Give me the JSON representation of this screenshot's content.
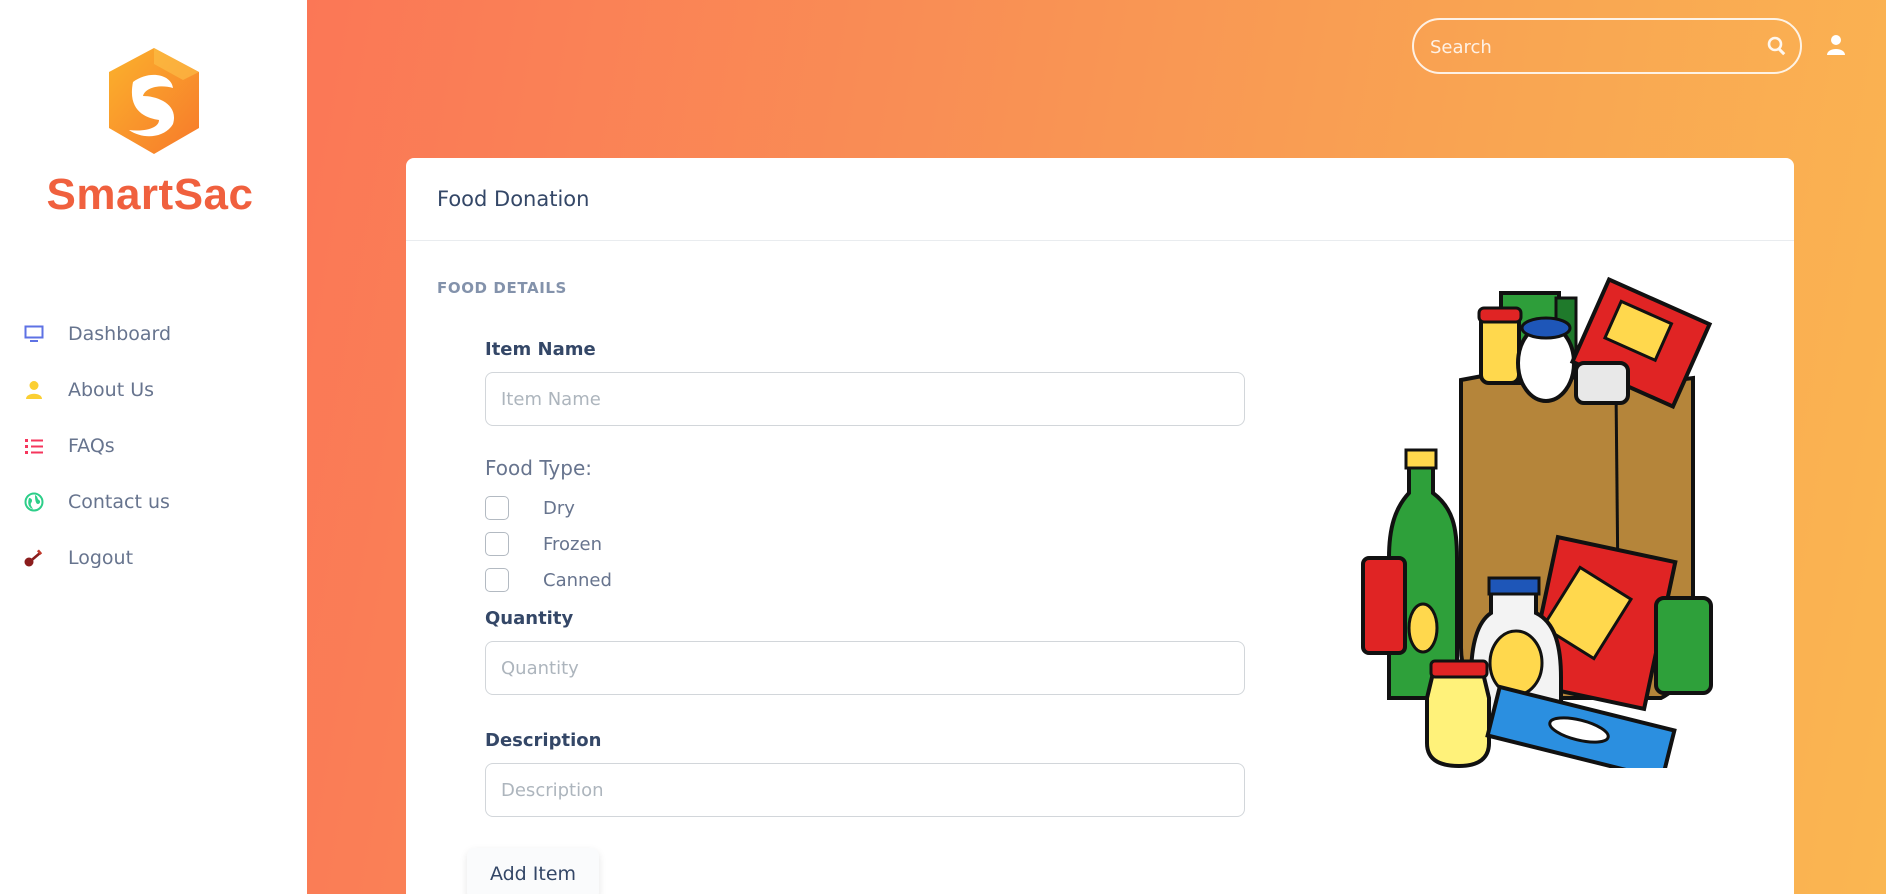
{
  "brand": {
    "name": "SmartSac",
    "color": "#f0603e"
  },
  "sidebar": {
    "items": [
      {
        "label": "Dashboard",
        "icon": "monitor-icon",
        "color": "#5e72e4"
      },
      {
        "label": "About Us",
        "icon": "user-icon",
        "color": "#fbcf33"
      },
      {
        "label": "FAQs",
        "icon": "list-icon",
        "color": "#f5365c"
      },
      {
        "label": "Contact us",
        "icon": "globe-icon",
        "color": "#2dce89"
      },
      {
        "label": "Logout",
        "icon": "key-icon",
        "color": "#8b1d1d"
      }
    ]
  },
  "header": {
    "search": {
      "placeholder": "Search",
      "icon": "search-icon"
    },
    "account_icon": "user-icon"
  },
  "card": {
    "title": "Food Donation",
    "section_title": "FOOD DETAILS",
    "fields": {
      "item_name": {
        "label": "Item Name",
        "placeholder": "Item Name",
        "value": ""
      },
      "quantity": {
        "label": "Quantity",
        "placeholder": "Quantity",
        "value": ""
      },
      "description": {
        "label": "Description",
        "placeholder": "Description",
        "value": ""
      }
    },
    "food_type": {
      "label": "Food Type:",
      "options": [
        {
          "label": "Dry",
          "checked": false
        },
        {
          "label": "Frozen",
          "checked": false
        },
        {
          "label": "Canned",
          "checked": false
        }
      ]
    },
    "add_button": "Add Item",
    "illustration": "grocery-bag-illustration"
  },
  "colors": {
    "gradient_start": "#fb7756",
    "gradient_end": "#fab651",
    "text_dark": "#344767",
    "text_muted": "#67748e"
  }
}
